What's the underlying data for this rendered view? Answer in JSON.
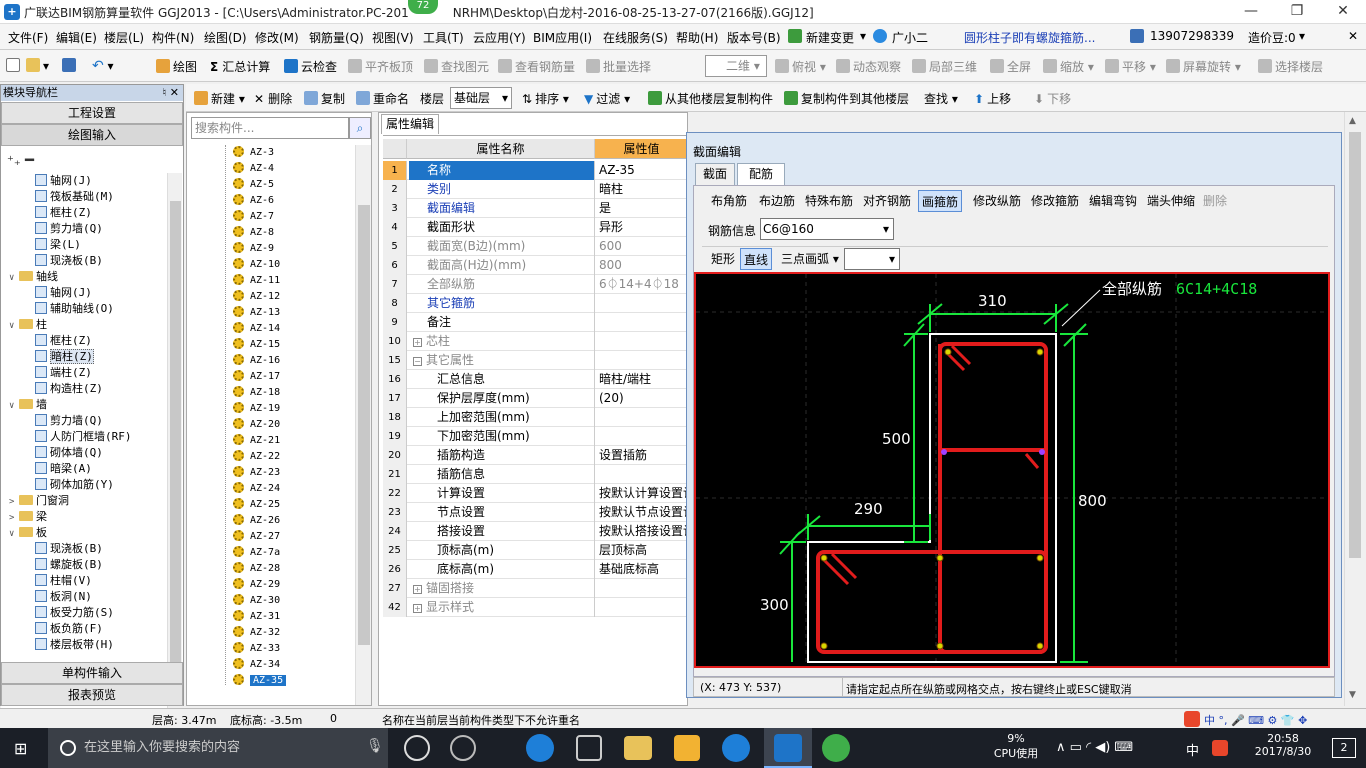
{
  "window": {
    "title": "广联达BIM钢筋算量软件 GGJ2013 - [C:\\Users\\Administrator.PC-201",
    "title_tail": "NRHM\\Desktop\\白龙村-2016-08-25-13-27-07(2166版).GGJ12]",
    "badge": "72",
    "min": "—",
    "restore": "❐",
    "close": "✕"
  },
  "menubar": {
    "items": [
      "文件(F)",
      "编辑(E)",
      "楼层(L)",
      "构件(N)",
      "绘图(D)",
      "修改(M)",
      "钢筋量(Q)",
      "视图(V)",
      "工具(T)",
      "云应用(Y)",
      "BIM应用(I)",
      "在线服务(S)",
      "帮助(H)",
      "版本号(B)",
      "新建变更",
      "广小二",
      "圆形柱子即有螺旋箍筋..."
    ],
    "phone": "13907298339",
    "price": "造价豆:0",
    "dropdown_caret": "▾",
    "right_close": "✕"
  },
  "toolbar1": {
    "draw": "绘图",
    "sum": "汇总计算",
    "cloud_check": "云检查",
    "flat_top": "平齐板顶",
    "find_elem": "查找图元",
    "view_rebar": "查看钢筋量",
    "batch_select": "批量选择",
    "view_mode": "二维",
    "top_view": "俯视",
    "dynamic": "动态观察",
    "local3d": "局部三维",
    "fullscreen": "全屏",
    "zoom": "缩放",
    "pan": "平移",
    "rotate": "屏幕旋转",
    "select_floor": "选择楼层"
  },
  "nav": {
    "title": "模块导航栏",
    "pin": "♮ ✕",
    "project_settings": "工程设置",
    "draw_input": "绘图输入",
    "single_input": "单构件输入",
    "report_preview": "报表预览",
    "tree": [
      {
        "indent": 2,
        "type": "leaf",
        "label": "轴网(J)"
      },
      {
        "indent": 2,
        "type": "leaf",
        "label": "筏板基础(M)"
      },
      {
        "indent": 2,
        "type": "leaf",
        "label": "框柱(Z)"
      },
      {
        "indent": 2,
        "type": "leaf",
        "label": "剪力墙(Q)"
      },
      {
        "indent": 2,
        "type": "leaf",
        "label": "梁(L)"
      },
      {
        "indent": 2,
        "type": "leaf",
        "label": "现浇板(B)"
      },
      {
        "indent": 1,
        "type": "folder",
        "toggle": "∨",
        "label": "轴线"
      },
      {
        "indent": 2,
        "type": "leaf",
        "label": "轴网(J)"
      },
      {
        "indent": 2,
        "type": "leaf",
        "label": "辅助轴线(O)"
      },
      {
        "indent": 1,
        "type": "folder",
        "toggle": "∨",
        "label": "柱"
      },
      {
        "indent": 2,
        "type": "leaf",
        "label": "框柱(Z)"
      },
      {
        "indent": 2,
        "type": "leaf",
        "label": "暗柱(Z)",
        "selected": true
      },
      {
        "indent": 2,
        "type": "leaf",
        "label": "端柱(Z)"
      },
      {
        "indent": 2,
        "type": "leaf",
        "label": "构造柱(Z)"
      },
      {
        "indent": 1,
        "type": "folder",
        "toggle": "∨",
        "label": "墙"
      },
      {
        "indent": 2,
        "type": "leaf",
        "label": "剪力墙(Q)"
      },
      {
        "indent": 2,
        "type": "leaf",
        "label": "人防门框墙(RF)"
      },
      {
        "indent": 2,
        "type": "leaf",
        "label": "砌体墙(Q)"
      },
      {
        "indent": 2,
        "type": "leaf",
        "label": "暗梁(A)"
      },
      {
        "indent": 2,
        "type": "leaf",
        "label": "砌体加筋(Y)"
      },
      {
        "indent": 1,
        "type": "folder",
        "toggle": ">",
        "label": "门窗洞"
      },
      {
        "indent": 1,
        "type": "folder",
        "toggle": ">",
        "label": "梁"
      },
      {
        "indent": 1,
        "type": "folder",
        "toggle": "∨",
        "label": "板"
      },
      {
        "indent": 2,
        "type": "leaf",
        "label": "现浇板(B)"
      },
      {
        "indent": 2,
        "type": "leaf",
        "label": "螺旋板(B)"
      },
      {
        "indent": 2,
        "type": "leaf",
        "label": "柱帽(V)"
      },
      {
        "indent": 2,
        "type": "leaf",
        "label": "板洞(N)"
      },
      {
        "indent": 2,
        "type": "leaf",
        "label": "板受力筋(S)"
      },
      {
        "indent": 2,
        "type": "leaf",
        "label": "板负筋(F)"
      },
      {
        "indent": 2,
        "type": "leaf",
        "label": "楼层板带(H)"
      }
    ]
  },
  "comp_toolbar": {
    "new": "新建",
    "delete": "删除",
    "copy": "复制",
    "rename": "重命名",
    "floor_label": "楼层",
    "floor_value": "基础层",
    "sort": "排序",
    "filter": "过滤",
    "copy_from": "从其他楼层复制构件",
    "copy_to": "复制构件到其他楼层",
    "find": "查找",
    "up": "上移",
    "down": "下移"
  },
  "components": {
    "search_placeholder": "搜索构件...",
    "search_icon": "⌕",
    "items": [
      "AZ-3",
      "AZ-4",
      "AZ-5",
      "AZ-6",
      "AZ-7",
      "AZ-8",
      "AZ-9",
      "AZ-10",
      "AZ-11",
      "AZ-12",
      "AZ-13",
      "AZ-14",
      "AZ-15",
      "AZ-16",
      "AZ-17",
      "AZ-18",
      "AZ-19",
      "AZ-20",
      "AZ-21",
      "AZ-22",
      "AZ-23",
      "AZ-24",
      "AZ-25",
      "AZ-26",
      "AZ-27",
      "AZ-7a",
      "AZ-28",
      "AZ-29",
      "AZ-30",
      "AZ-31",
      "AZ-32",
      "AZ-33",
      "AZ-34",
      "AZ-35"
    ],
    "selected": "AZ-35"
  },
  "properties": {
    "tab": "属性编辑",
    "col_name": "属性名称",
    "col_value": "属性值",
    "rows": [
      {
        "num": "1",
        "name": "名称",
        "value": "AZ-35",
        "style": "blue",
        "sel": true
      },
      {
        "num": "2",
        "name": "类别",
        "value": "暗柱",
        "style": "blue"
      },
      {
        "num": "3",
        "name": "截面编辑",
        "value": "是",
        "style": "blue"
      },
      {
        "num": "4",
        "name": "截面形状",
        "value": "异形",
        "style": ""
      },
      {
        "num": "5",
        "name": "截面宽(B边)(mm)",
        "value": "600",
        "style": "grey"
      },
      {
        "num": "6",
        "name": "截面高(H边)(mm)",
        "value": "800",
        "style": "grey"
      },
      {
        "num": "7",
        "name": "全部纵筋",
        "value": "6⏀14+4⏀18",
        "style": "grey"
      },
      {
        "num": "8",
        "name": "其它箍筋",
        "value": "",
        "style": "blue"
      },
      {
        "num": "9",
        "name": "备注",
        "value": "",
        "style": ""
      },
      {
        "num": "10",
        "name": "芯柱",
        "value": "",
        "style": "grey",
        "box": "+"
      },
      {
        "num": "15",
        "name": "其它属性",
        "value": "",
        "style": "grey",
        "box": "−"
      },
      {
        "num": "16",
        "name": "汇总信息",
        "value": "暗柱/端柱",
        "style": "",
        "sub": true
      },
      {
        "num": "17",
        "name": "保护层厚度(mm)",
        "value": "(20)",
        "style": "",
        "sub": true
      },
      {
        "num": "18",
        "name": "上加密范围(mm)",
        "value": "",
        "style": "",
        "sub": true
      },
      {
        "num": "19",
        "name": "下加密范围(mm)",
        "value": "",
        "style": "",
        "sub": true
      },
      {
        "num": "20",
        "name": "插筋构造",
        "value": "设置插筋",
        "style": "",
        "sub": true
      },
      {
        "num": "21",
        "name": "插筋信息",
        "value": "",
        "style": "",
        "sub": true
      },
      {
        "num": "22",
        "name": "计算设置",
        "value": "按默认计算设置计",
        "style": "",
        "sub": true
      },
      {
        "num": "23",
        "name": "节点设置",
        "value": "按默认节点设置计",
        "style": "",
        "sub": true
      },
      {
        "num": "24",
        "name": "搭接设置",
        "value": "按默认搭接设置计",
        "style": "",
        "sub": true
      },
      {
        "num": "25",
        "name": "顶标高(m)",
        "value": "层顶标高",
        "style": "",
        "sub": true
      },
      {
        "num": "26",
        "name": "底标高(m)",
        "value": "基础底标高",
        "style": "",
        "sub": true
      },
      {
        "num": "27",
        "name": "锚固搭接",
        "value": "",
        "style": "grey",
        "box": "+"
      },
      {
        "num": "42",
        "name": "显示样式",
        "value": "",
        "style": "grey",
        "box": "+"
      }
    ]
  },
  "dialog": {
    "title": "截面编辑",
    "tabs": [
      "截面",
      "配筋"
    ],
    "tools": [
      "布角筋",
      "布边筋",
      "特殊布筋",
      "对齐钢筋",
      "画箍筋",
      "修改纵筋",
      "修改箍筋",
      "编辑弯钩",
      "端头伸缩",
      "删除"
    ],
    "rebar_info_label": "钢筋信息",
    "rebar_info_value": "C6@160",
    "draw_modes": [
      "矩形",
      "直线",
      "三点画弧"
    ],
    "coords": "(X: 473 Y: 537)",
    "hint": "请指定起点所在纵筋或网格交点，按右键终止或ESC键取消",
    "canvas": {
      "dims": [
        "310",
        "500",
        "800",
        "290",
        "300"
      ],
      "label_all": "全部纵筋",
      "label_value": "6C14+4C18"
    }
  },
  "statusbar": {
    "floor_height": "层高: 3.47m",
    "bottom_elev": "底标高: -3.5m",
    "zero": "0",
    "message": "名称在当前层当前构件类型下不允许重名"
  },
  "taskbar": {
    "search": "在这里输入你要搜索的内容",
    "cpu_pct": "9%",
    "cpu_label": "CPU使用",
    "ime": "中",
    "time": "20:58",
    "date": "2017/8/30",
    "notif": "2",
    "tray_right": "中 °, 🎤 ⌨ ⚙ 👕 ✥",
    "tray_sys": "∧ ▭ ◜ ◀) ⌨"
  },
  "colors": {
    "accent": "#1e74c8",
    "rebar": "#e21c1c",
    "dim": "#19e63c",
    "outline": "#ffffff"
  }
}
